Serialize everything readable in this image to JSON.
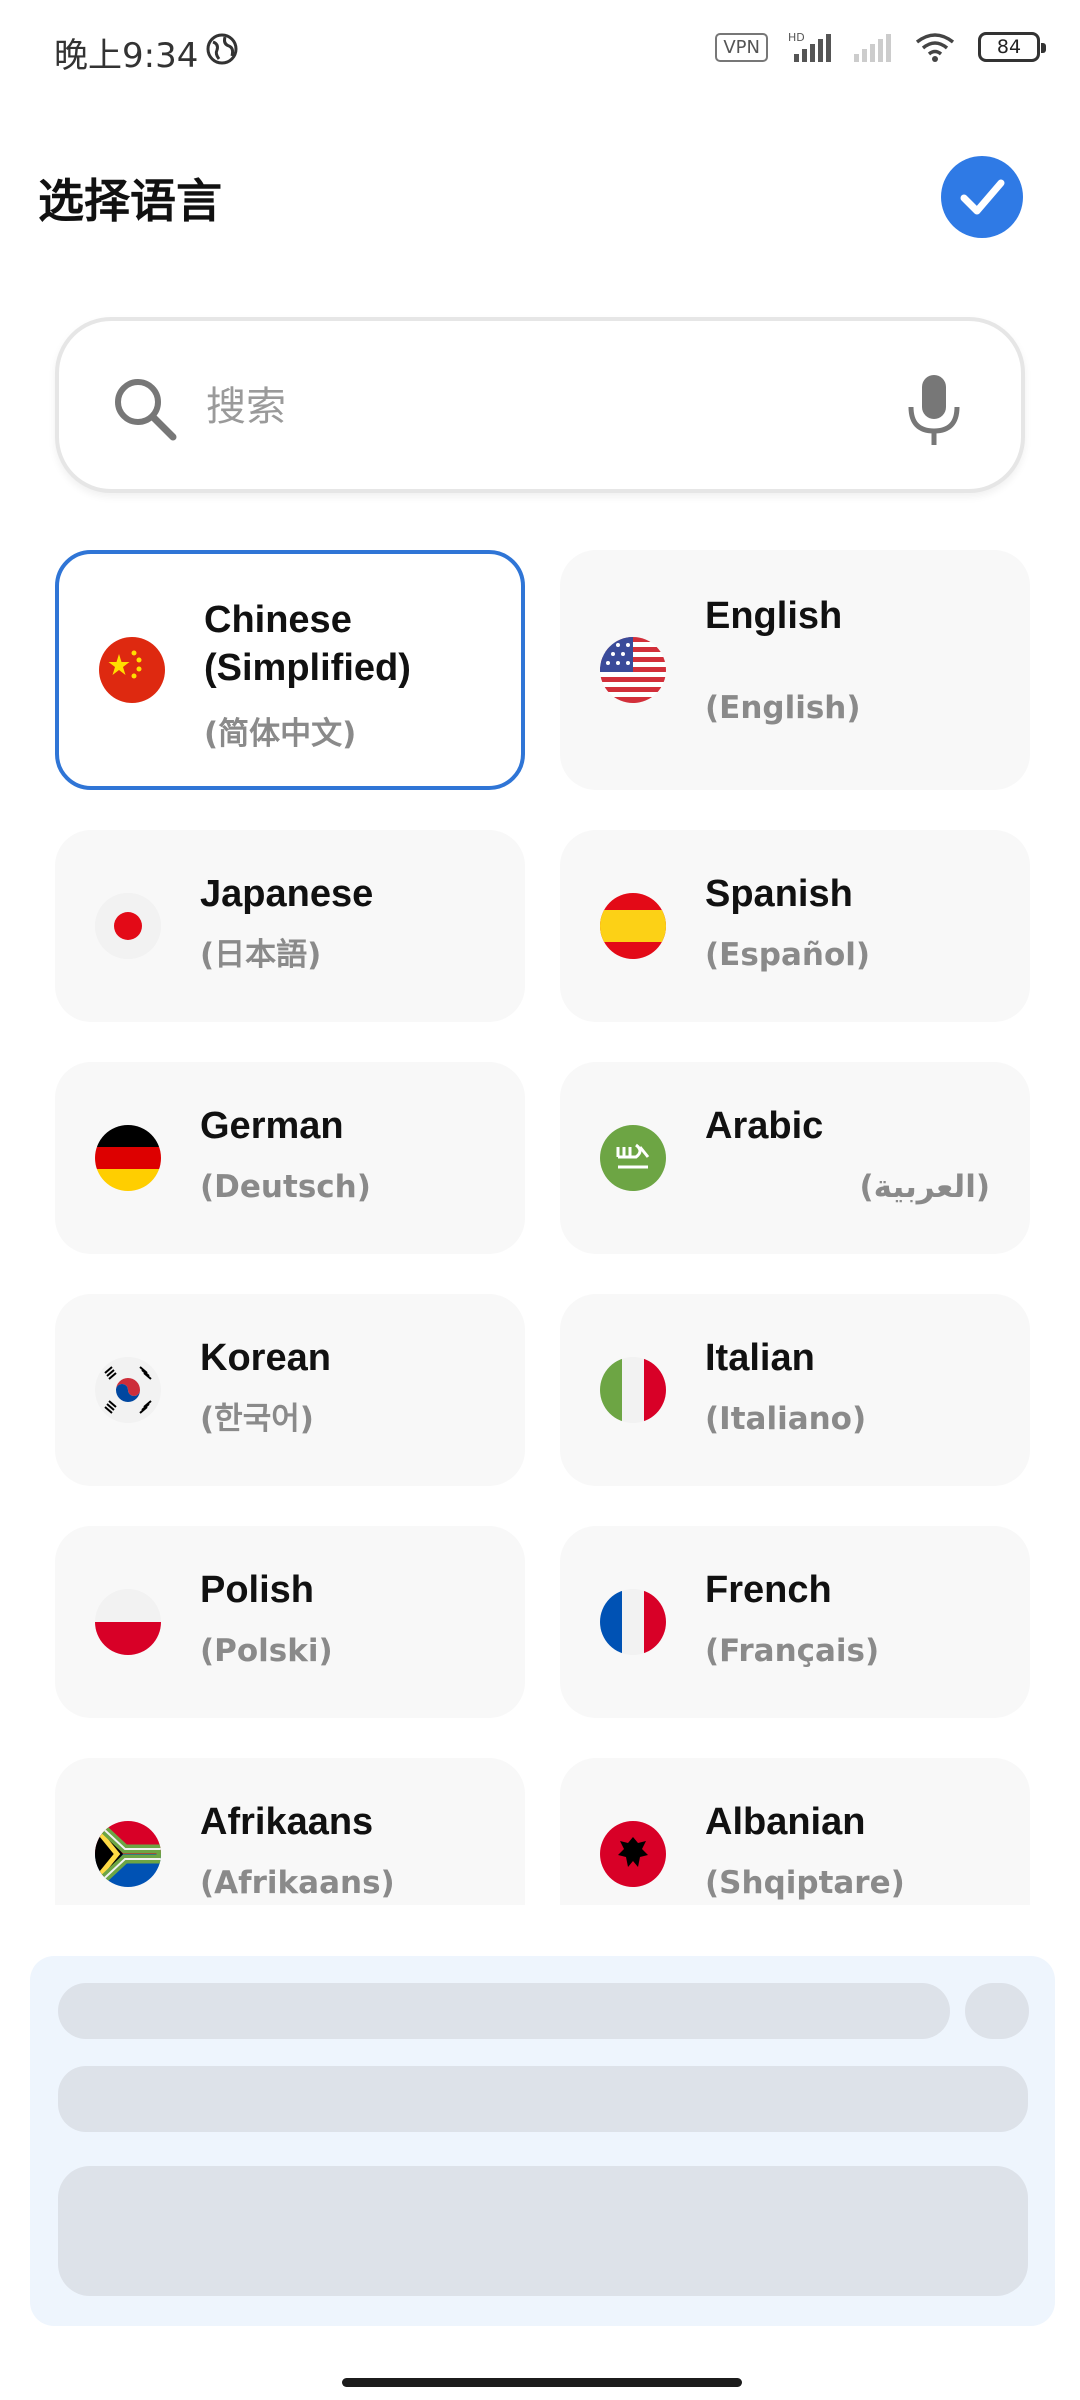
{
  "status_bar": {
    "time": "晚上9:34",
    "vpn": "VPN",
    "network": "HD",
    "battery": "84"
  },
  "header": {
    "title": "选择语言",
    "confirm_icon": "check-icon"
  },
  "search": {
    "placeholder": "搜索",
    "value": "",
    "search_icon": "search-icon",
    "mic_icon": "microphone-icon"
  },
  "languages": [
    {
      "name": "Chinese (Simplified)",
      "native": "(简体中文)",
      "selected": true,
      "flag": "china-flag-icon"
    },
    {
      "name": "English",
      "native": "(English)",
      "selected": false,
      "flag": "usa-flag-icon"
    },
    {
      "name": "Japanese",
      "native": "(日本語)",
      "selected": false,
      "flag": "japan-flag-icon"
    },
    {
      "name": "Spanish",
      "native": "(Español)",
      "selected": false,
      "flag": "spain-flag-icon"
    },
    {
      "name": "German",
      "native": "(Deutsch)",
      "selected": false,
      "flag": "germany-flag-icon"
    },
    {
      "name": "Arabic",
      "native": "(العربية)",
      "selected": false,
      "flag": "saudi-arabia-flag-icon"
    },
    {
      "name": "Korean",
      "native": "(한국어)",
      "selected": false,
      "flag": "south-korea-flag-icon"
    },
    {
      "name": "Italian",
      "native": "(Italiano)",
      "selected": false,
      "flag": "italy-flag-icon"
    },
    {
      "name": "Polish",
      "native": "(Polski)",
      "selected": false,
      "flag": "poland-flag-icon"
    },
    {
      "name": "French",
      "native": "(Français)",
      "selected": false,
      "flag": "france-flag-icon"
    },
    {
      "name": "Afrikaans",
      "native": "(Afrikaans)",
      "selected": false,
      "flag": "south-africa-flag-icon"
    },
    {
      "name": "Albanian",
      "native": "(Shqiptare)",
      "selected": false,
      "flag": "albania-flag-icon"
    }
  ],
  "colors": {
    "accent": "#2f7ae5",
    "card_bg": "#f8f8f8",
    "secondary_text": "#8a8a8a",
    "skeleton_bg": "#eef5fd",
    "skeleton_bar": "#dde2e9"
  }
}
